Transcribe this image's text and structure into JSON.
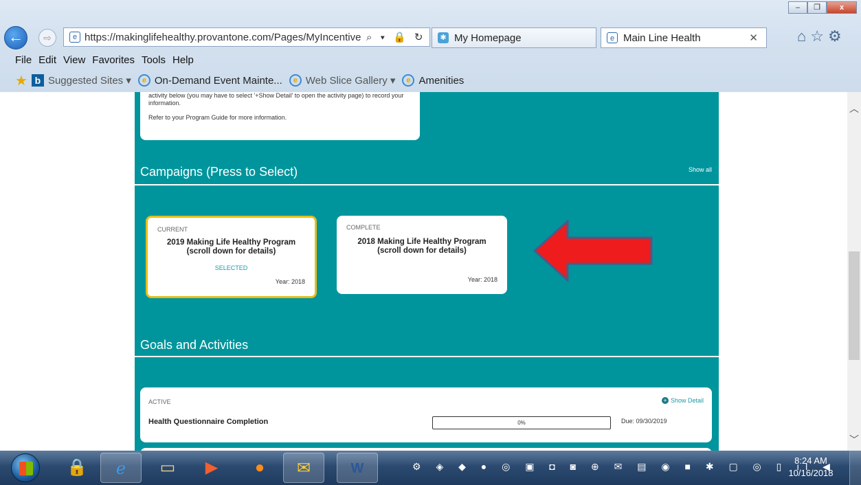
{
  "browser": {
    "url": "https://makinglifehealthy.provantone.com/Pages/MyIncentive",
    "tabs": [
      {
        "label": "My Homepage"
      },
      {
        "label": "Main Line Health"
      }
    ],
    "window_buttons": [
      "–",
      "❐",
      "x"
    ],
    "tools_glyphs": "⌕ ▾ 🔒 ↻",
    "menu": [
      "File",
      "Edit",
      "View",
      "Favorites",
      "Tools",
      "Help"
    ],
    "favorites": [
      {
        "label": "Suggested Sites ▾"
      },
      {
        "label": "On-Demand Event Mainte..."
      },
      {
        "label": "Web Slice Gallery ▾"
      },
      {
        "label": "Amenities"
      }
    ]
  },
  "page": {
    "intro_text_1": "activity below (you may have to select '+Show Detail' to open the activity page) to record your information.",
    "intro_text_2": "Refer to your Program Guide for more information.",
    "campaigns": {
      "title": "Campaigns (Press to Select)",
      "show_all": "Show all",
      "cards": [
        {
          "status": "CURRENT",
          "name": "2019 Making Life Healthy Program (scroll down for details)",
          "selected": "SELECTED",
          "year": "Year: 2018"
        },
        {
          "status": "COMPLETE",
          "name": "2018 Making Life Healthy Program (scroll down for details)",
          "selected": "",
          "year": "Year: 2018"
        }
      ]
    },
    "goals": {
      "title": "Goals and Activities",
      "activity": {
        "status": "ACTIVE",
        "show_detail": "Show Detail",
        "name": "Health Questionnaire Completion",
        "progress": "0%",
        "progress_value": 0,
        "due": "Due: 09/30/2019"
      }
    }
  },
  "taskbar": {
    "time": "8:24 AM",
    "date": "10/16/2018"
  },
  "colors": {
    "teal": "#00959c",
    "selected_border": "#e4bf1b",
    "arrow": "#ee1c1c"
  }
}
